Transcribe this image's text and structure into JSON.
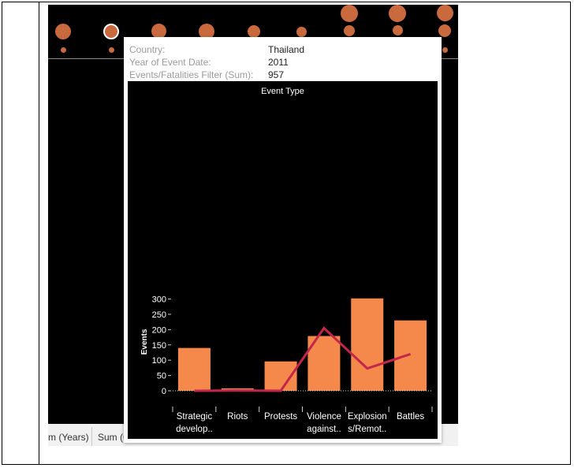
{
  "footer": {
    "tab_years": "m (Years)",
    "tab_sum": "Sum (C"
  },
  "tooltip": {
    "country_label": "Country:",
    "country_value": "Thailand",
    "year_label": "Year of Event Date:",
    "year_value": "2011",
    "filter_label": "Events/Fatalities Filter (Sum):",
    "filter_value": "957"
  },
  "colors": {
    "bar": "#f4894b",
    "line": "#c2264b",
    "bubble": "#c86a3e",
    "background": "#000000"
  },
  "chart_data": {
    "type": "bar",
    "title": "Event Type",
    "ylabel": "Events",
    "xlabel": "",
    "ylim": [
      0,
      320
    ],
    "yticks": [
      0,
      50,
      100,
      150,
      200,
      250,
      300
    ],
    "categories": [
      [
        "Strategic",
        "develop.."
      ],
      [
        "Riots"
      ],
      [
        "Protests"
      ],
      [
        "Violence",
        "against.."
      ],
      [
        "Explosion",
        "s/Remot.."
      ],
      [
        "Battles"
      ]
    ],
    "series": [
      {
        "type": "bar",
        "values": [
          140,
          8,
          96,
          179,
          302,
          230
        ]
      },
      {
        "type": "line",
        "values": [
          0,
          1,
          0,
          205,
          73,
          120
        ]
      }
    ],
    "grid": false,
    "zero_line": "dotted"
  }
}
